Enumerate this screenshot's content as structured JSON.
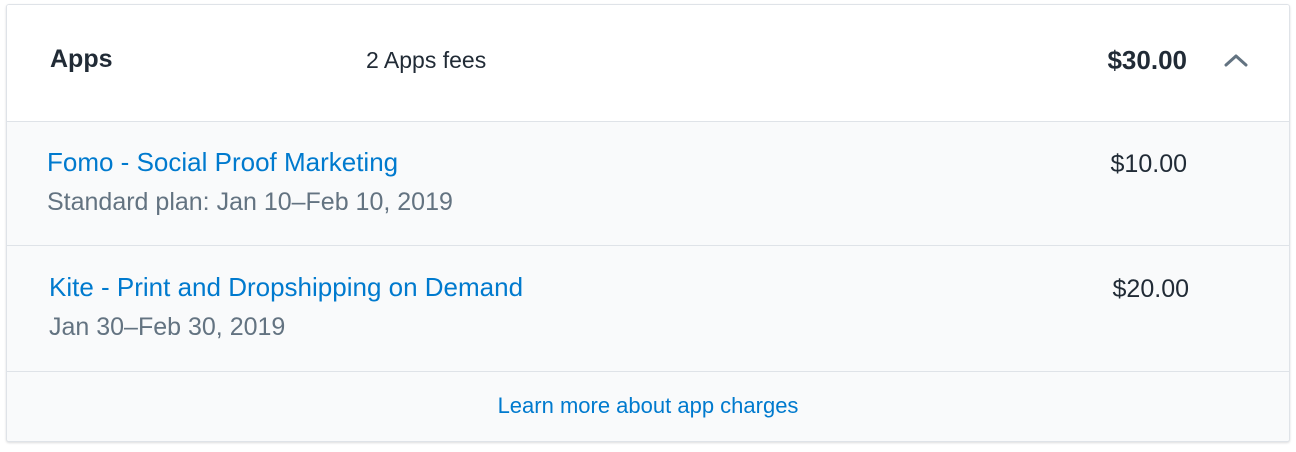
{
  "header": {
    "title": "Apps",
    "subtitle": "2 Apps fees",
    "total": "$30.00",
    "toggle_icon": "chevron-up-icon"
  },
  "apps": [
    {
      "name": "Fomo - Social Proof Marketing",
      "detail": "Standard plan: Jan 10–Feb 10, 2019",
      "amount": "$10.00"
    },
    {
      "name": "Kite - Print and Dropshipping on Demand",
      "detail": "Jan 30–Feb 30, 2019",
      "amount": "$20.00"
    }
  ],
  "footer": {
    "link_label": "Learn more about app charges"
  },
  "colors": {
    "link": "#007ace",
    "text": "#212b36",
    "subdued": "#637381",
    "body_background": "#f9fafb",
    "border": "#dfe3e8"
  }
}
